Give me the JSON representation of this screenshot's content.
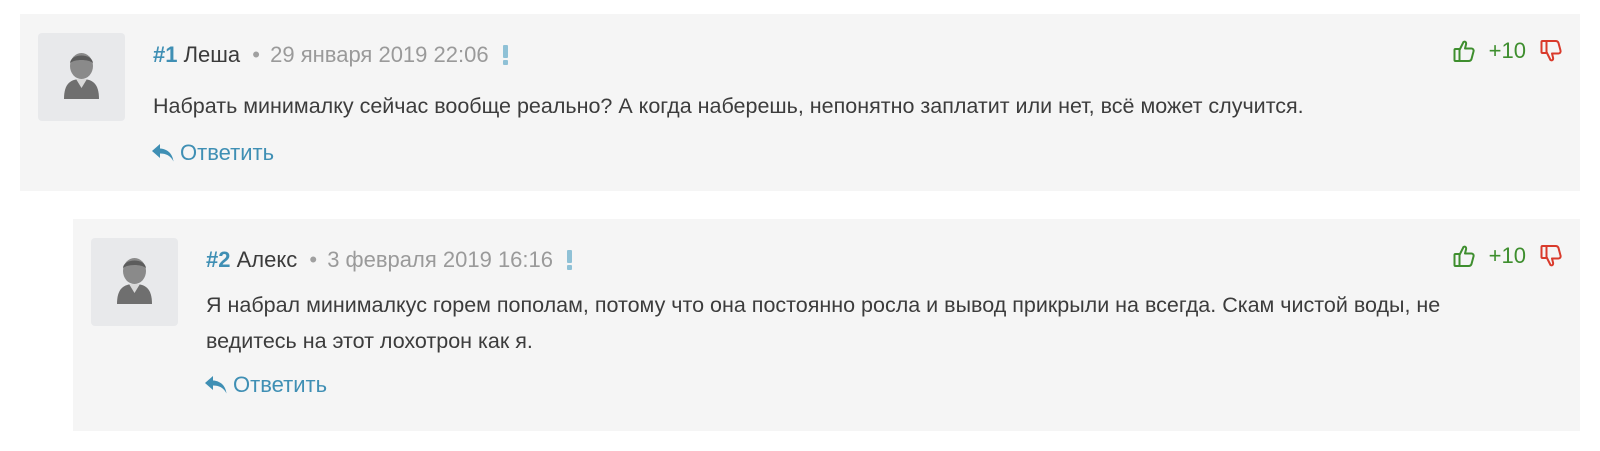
{
  "colors": {
    "card_bg": "#f5f5f5",
    "accent_blue": "#3f8fb4",
    "vote_green": "#3e8e2e",
    "vote_red": "#d93a2b",
    "meta_gray": "#9a9a9a"
  },
  "icons": {
    "avatar": "user-avatar-icon",
    "flag": "report-flag-icon",
    "like": "thumbs-up-icon",
    "dislike": "thumbs-down-icon",
    "reply": "reply-arrow-icon"
  },
  "comments": [
    {
      "number": "#1",
      "author": "Леша",
      "separator": "•",
      "date": "29 января 2019 22:06",
      "score": "+10",
      "text": "Набрать минималку сейчас вообще реально? А когда наберешь, непонятно заплатит или нет, всё может случится.",
      "reply_label": "Ответить"
    },
    {
      "number": "#2",
      "author": "Алекс",
      "separator": "•",
      "date": "3 февраля 2019 16:16",
      "score": "+10",
      "text": "Я набрал минималкус горем пополам, потому что она постоянно росла и вывод прикрыли на всегда. Скам чистой воды, не ведитесь на этот лохотрон как я.",
      "reply_label": "Ответить"
    }
  ]
}
